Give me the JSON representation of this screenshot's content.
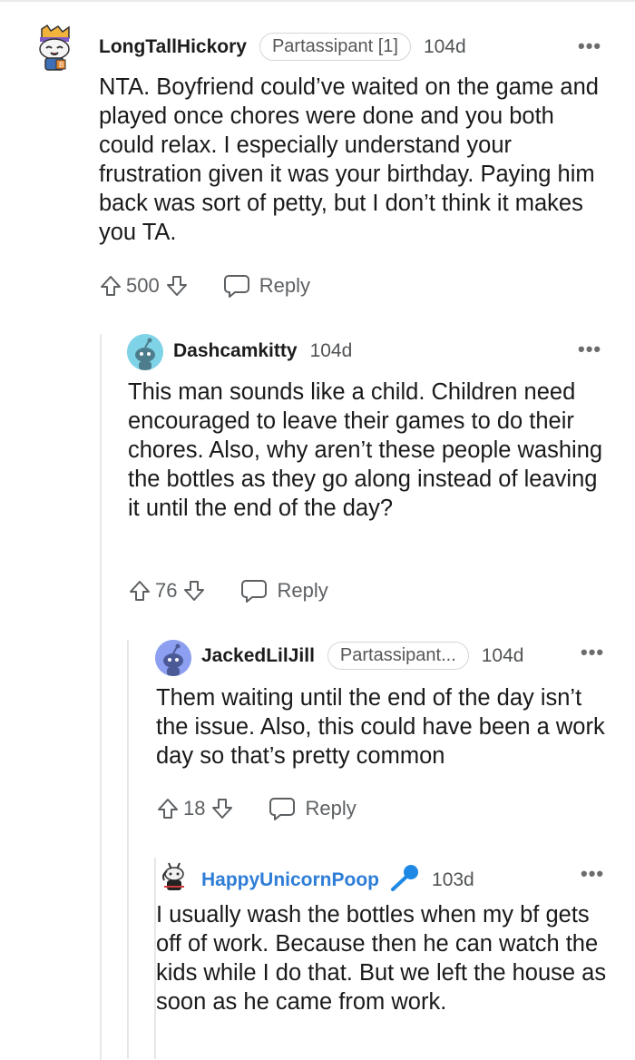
{
  "comments": [
    {
      "username": "LongTallHickory",
      "flair": "Partassipant [1]",
      "age": "104d",
      "body": "NTA. Boyfriend could’ve waited on the game and played once chores were done and you both could relax. I especially understand your frustration given it was your birthday. Paying him back was sort of petty, but I don’t think it makes you TA.",
      "score": "500",
      "reply_label": "Reply",
      "more": "•••"
    },
    {
      "username": "Dashcamkitty",
      "age": "104d",
      "body": "This man sounds like a child. Children need encouraged to leave their games to do their chores. Also, why aren’t these people washing the bottles as they go along instead of leaving it until the end of the day?",
      "score": "76",
      "reply_label": "Reply",
      "more": "•••"
    },
    {
      "username": "JackedLilJill",
      "flair": "Partassipant...",
      "age": "104d",
      "body": "Them waiting until the end of the day isn’t the issue. Also, this could have been a work day so that’s pretty common",
      "score": "18",
      "reply_label": "Reply",
      "more": "•••"
    },
    {
      "username": "HappyUnicornPoop",
      "age": "103d",
      "body": "I usually wash the bottles when my bf gets off of work. Because then he can watch the kids while I do that. But we left the house as soon as he came from work.",
      "more": "•••"
    }
  ],
  "colors": {
    "username_highlight": "#2e7dd7",
    "thread_line": "#e6e7e8",
    "text": "#1a1a1b",
    "meta": "#5d6063"
  }
}
